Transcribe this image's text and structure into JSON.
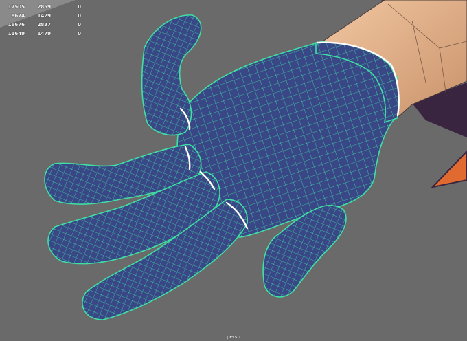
{
  "viewport": {
    "camera_label": "persp",
    "background_color": "#6a6a6a"
  },
  "hud": {
    "rows": [
      {
        "v0": "17505",
        "v1": "2859",
        "v2": "0"
      },
      {
        "v0": "8674",
        "v1": "1429",
        "v2": "0"
      },
      {
        "v0": "16676",
        "v1": "2837",
        "v2": "0"
      },
      {
        "v0": "11649",
        "v1": "1479",
        "v2": "0"
      }
    ]
  },
  "mesh": {
    "fill_color": "#3a4787",
    "wire_color": "#3fe0a3",
    "seam_color": "#ffffff",
    "sleeve_color": "#e8b690",
    "shadow_color": "#3a2540",
    "accent_color": "#e06a30"
  }
}
